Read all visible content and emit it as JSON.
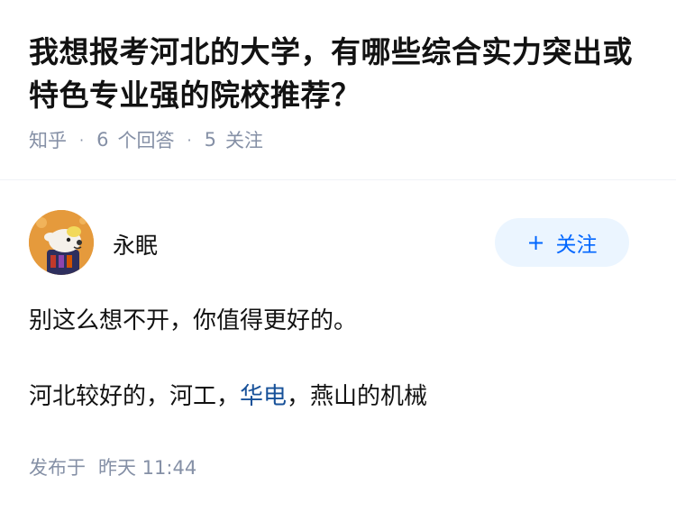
{
  "question": {
    "title": "我想报考河北的大学，有哪些综合实力突出或特色专业强的院校推荐？",
    "site": "知乎",
    "answer_count": "6",
    "answer_label": "个回答",
    "follow_count": "5",
    "follow_label": "关注"
  },
  "answer": {
    "author_name": "永眠",
    "follow_button_label": "关注",
    "paragraph_1": "别这么想不开，你值得更好的。",
    "paragraph_2_parts": {
      "before": "河北较好的，河工，",
      "link": "华电",
      "after": "，燕山的机械"
    },
    "publish_label": "发布于",
    "publish_time": "昨天 11:44"
  },
  "colors": {
    "title": "#121212",
    "meta": "#8590a6",
    "accent": "#0066ff",
    "follow_bg": "#ebf5ff",
    "link": "#175199",
    "avatar_bg": "#e59a3c"
  },
  "icons": {
    "follow_plus": "plus-icon"
  }
}
